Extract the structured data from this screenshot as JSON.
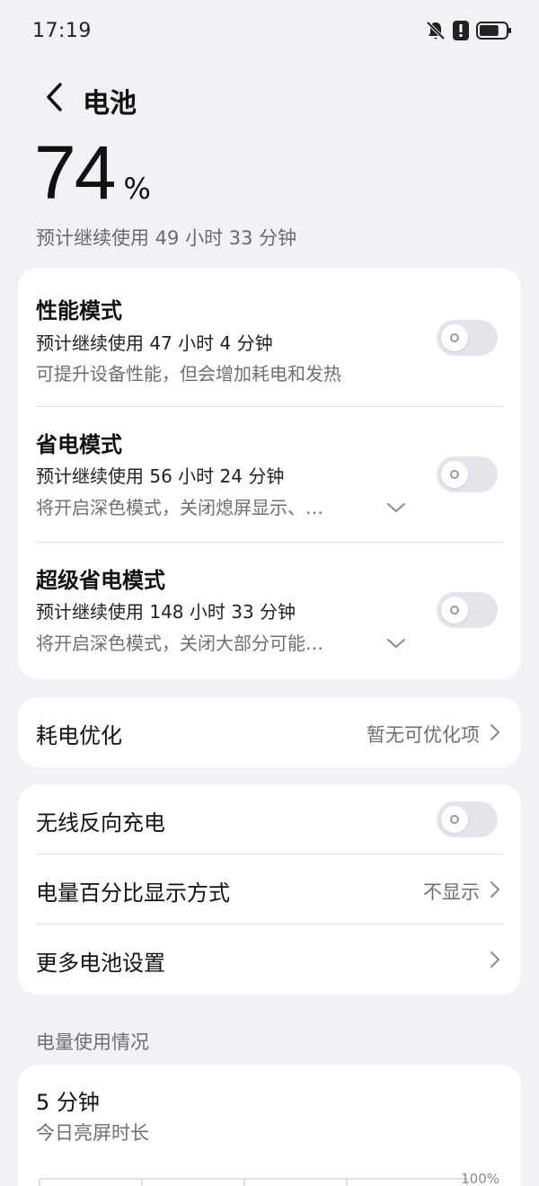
{
  "status_bar": {
    "time": "17:19",
    "icons": [
      "bell-muted-icon",
      "alert-icon",
      "battery-icon"
    ],
    "battery_fraction": 0.74
  },
  "header": {
    "back_icon": "back-arrow-icon",
    "title": "电池"
  },
  "battery": {
    "level": "74",
    "unit": "%",
    "estimate": "预计继续使用 49 小时 33 分钟"
  },
  "modes": [
    {
      "title": "性能模式",
      "estimate": "预计继续使用 47 小时 4 分钟",
      "description": "可提升设备性能，但会增加耗电和发热",
      "enabled": false
    },
    {
      "title": "省电模式",
      "estimate": "预计继续使用 56 小时 24 分钟",
      "description": "将开启深色模式，关闭熄屏显示、…",
      "enabled": false
    },
    {
      "title": "超级省电模式",
      "estimate": "预计继续使用 148 小时 33 分钟",
      "description": "将开启深色模式，关闭大部分可能…",
      "enabled": false
    }
  ],
  "optimization": {
    "label": "耗电优化",
    "value": "暂无可优化项"
  },
  "settings": {
    "wireless_reverse": {
      "label": "无线反向充电",
      "enabled": false
    },
    "percentage_display": {
      "label": "电量百分比显示方式",
      "value": "不显示"
    },
    "more": {
      "label": "更多电池设置"
    }
  },
  "usage": {
    "section_title": "电量使用情况",
    "screen_time": "5 分钟",
    "screen_time_caption": "今日亮屏时长",
    "axis_top_label": "100%"
  },
  "colors": {
    "background": "#f1f2f6",
    "card": "#ffffff",
    "toggle_off": "#e4e5ea",
    "secondary_text": "#6f6f73"
  }
}
